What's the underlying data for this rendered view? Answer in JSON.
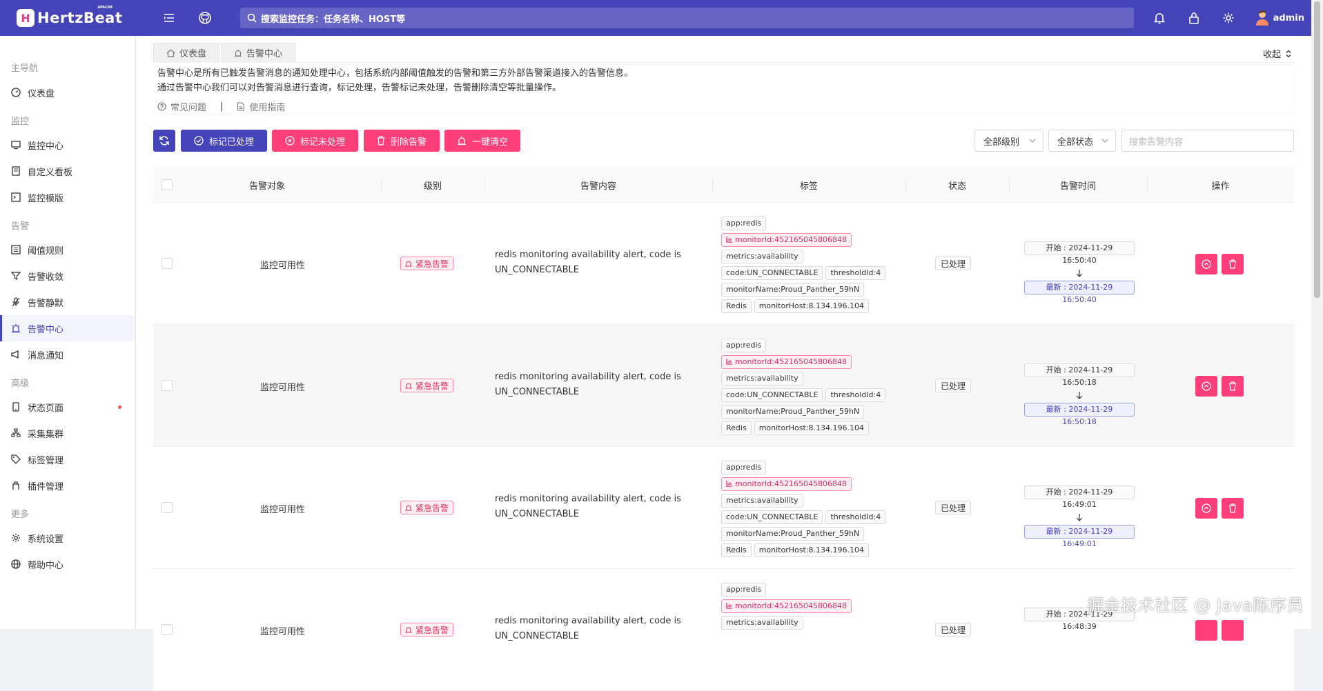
{
  "app": {
    "logo_letter": "H",
    "logo_text": "HertzBeat",
    "logo_sup": "APACHE",
    "search_placeholder": "搜索监控任务：任务名称、HOST等",
    "user": "admin"
  },
  "sidebar": {
    "groups": [
      "主导航",
      "监控",
      "告警",
      "高级",
      "更多"
    ],
    "items": [
      {
        "label": "仪表盘"
      },
      {
        "label": "监控中心"
      },
      {
        "label": "自定义看板"
      },
      {
        "label": "监控模版"
      },
      {
        "label": "阈值规则"
      },
      {
        "label": "告警收敛"
      },
      {
        "label": "告警静默"
      },
      {
        "label": "告警中心",
        "active": true
      },
      {
        "label": "消息通知"
      },
      {
        "label": "状态页面"
      },
      {
        "label": "采集集群"
      },
      {
        "label": "标签管理"
      },
      {
        "label": "插件管理"
      },
      {
        "label": "系统设置"
      },
      {
        "label": "帮助中心"
      }
    ]
  },
  "breadcrumb": {
    "home": "仪表盘",
    "current": "告警中心",
    "collapse": "收起"
  },
  "info": {
    "line1": "告警中心是所有已触发告警消息的通知处理中心，包括系统内部阈值触发的告警和第三方外部告警渠道接入的告警信息。",
    "line2": "通过告警中心我们可以对告警消息进行查询，标记处理，告警标记未处理，告警删除清空等批量操作。",
    "faq": "常见问题",
    "sep": "|",
    "guide": "使用指南"
  },
  "toolbar": {
    "mark_handled": "标记已处理",
    "mark_unhandled": "标记未处理",
    "delete": "删除告警",
    "clear": "一键清空",
    "level_select": "全部级别",
    "status_select": "全部状态",
    "search_placeholder": "搜索告警内容"
  },
  "table": {
    "headers": {
      "target": "告警对象",
      "level": "级别",
      "content": "告警内容",
      "tags": "标签",
      "status": "状态",
      "time": "告警时间",
      "action": "操作"
    },
    "rows": [
      {
        "target": "监控可用性",
        "level": "紧急告警",
        "content": "redis monitoring availability alert, code is UN_CONNECTABLE",
        "tag_app": "app:redis",
        "tag_monitor_id": "monitorId:452165045806848",
        "tag_metrics": "metrics:availability",
        "tag_code": "code:UN_CONNECTABLE",
        "tag_threshold": "thresholdId:4",
        "tag_name": "monitorName:Proud_Panther_59hN",
        "tag_type": "Redis",
        "tag_host": "monitorHost:8.134.196.104",
        "status": "已处理",
        "start": "开始 : 2024-11-29 16:50:40",
        "latest": "最新 : 2024-11-29 16:50:40"
      },
      {
        "target": "监控可用性",
        "level": "紧急告警",
        "content": "redis monitoring availability alert, code is UN_CONNECTABLE",
        "tag_app": "app:redis",
        "tag_monitor_id": "monitorId:452165045806848",
        "tag_metrics": "metrics:availability",
        "tag_code": "code:UN_CONNECTABLE",
        "tag_threshold": "thresholdId:4",
        "tag_name": "monitorName:Proud_Panther_59hN",
        "tag_type": "Redis",
        "tag_host": "monitorHost:8.134.196.104",
        "status": "已处理",
        "start": "开始 : 2024-11-29 16:50:18",
        "latest": "最新 : 2024-11-29 16:50:18"
      },
      {
        "target": "监控可用性",
        "level": "紧急告警",
        "content": "redis monitoring availability alert, code is UN_CONNECTABLE",
        "tag_app": "app:redis",
        "tag_monitor_id": "monitorId:452165045806848",
        "tag_metrics": "metrics:availability",
        "tag_code": "code:UN_CONNECTABLE",
        "tag_threshold": "thresholdId:4",
        "tag_name": "monitorName:Proud_Panther_59hN",
        "tag_type": "Redis",
        "tag_host": "monitorHost:8.134.196.104",
        "status": "已处理",
        "start": "开始 : 2024-11-29 16:49:01",
        "latest": "最新 : 2024-11-29 16:49:01"
      },
      {
        "target": "监控可用性",
        "level": "紧急告警",
        "content": "redis monitoring availability alert, code is UN_CONNECTABLE",
        "tag_app": "app:redis",
        "tag_monitor_id": "monitorId:452165045806848",
        "tag_metrics": "metrics:availability",
        "status": "已处理",
        "start": "开始 : 2024-11-29 16:48:39"
      }
    ]
  },
  "watermark": "掘金技术社区 @ Java陈序员"
}
